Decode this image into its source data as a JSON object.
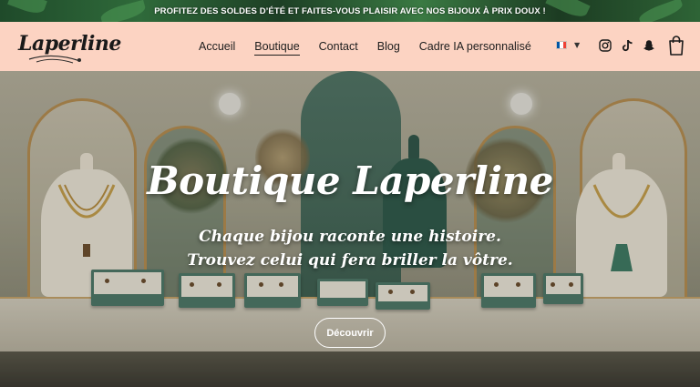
{
  "announcement": {
    "text": "PROFITEZ DES SOLDES D’ÉTÉ ET FAITES-VOUS PLAISIR AVEC NOS BIJOUX À PRIX DOUX !"
  },
  "header": {
    "logo_text": "Laperline",
    "nav": [
      {
        "label": "Accueil",
        "active": false
      },
      {
        "label": "Boutique",
        "active": true
      },
      {
        "label": "Contact",
        "active": false
      },
      {
        "label": "Blog",
        "active": false
      },
      {
        "label": "Cadre IA personnalisé",
        "active": false
      }
    ],
    "language": {
      "flag": "france-flag-icon",
      "colors": [
        "#0055a4",
        "#ffffff",
        "#ef4135"
      ]
    },
    "social_icons": [
      "instagram-icon",
      "tiktok-icon",
      "snapchat-icon"
    ],
    "cart_icon": "shopping-bag-icon"
  },
  "hero": {
    "title": "Boutique Laperline",
    "subtitle_line1": "Chaque bijou raconte une histoire.",
    "subtitle_line2": "Trouvez celui qui fera briller la vôtre.",
    "cta_label": "Découvrir"
  },
  "colors": {
    "header_bg": "#fcd3c2",
    "announcement_bg": "#2f6a3a",
    "text_dark": "#1d1d1d"
  }
}
